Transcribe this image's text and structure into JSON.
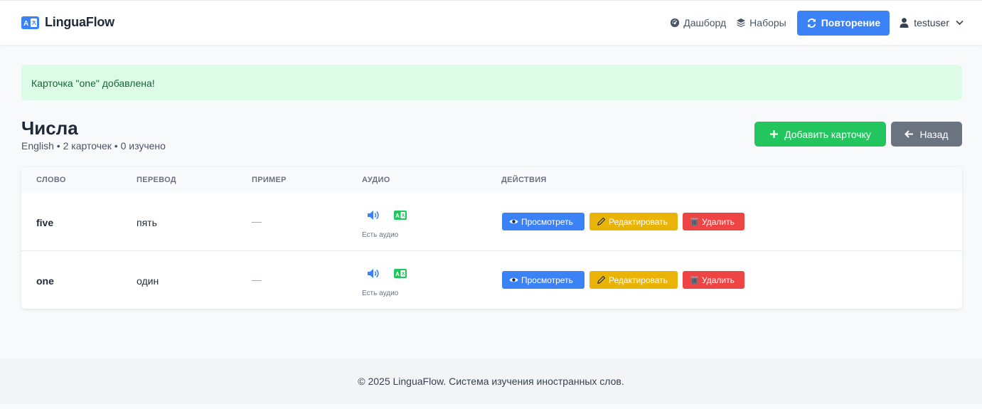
{
  "brand": {
    "name": "LinguaFlow"
  },
  "nav": {
    "dashboard": "Дашборд",
    "sets": "Наборы",
    "review": "Повторение",
    "user": "testuser"
  },
  "alert": {
    "text": "Карточка \"one\" добавлена!"
  },
  "page": {
    "title": "Числа",
    "subtitle": "English • 2 карточек • 0 изучено",
    "add_button": "Добавить карточку",
    "back_button": "Назад"
  },
  "table": {
    "headers": [
      "СЛОВО",
      "ПЕРЕВОД",
      "ПРИМЕР",
      "АУДИО",
      "ДЕЙСТВИЯ"
    ],
    "rows": [
      {
        "word": "five",
        "translation": "пять",
        "example": "—",
        "audio_note": "Есть аудио"
      },
      {
        "word": "one",
        "translation": "один",
        "example": "—",
        "audio_note": "Есть аудио"
      }
    ],
    "actions": {
      "view": "Просмотреть",
      "edit": "Редактировать",
      "delete": "Удалить"
    }
  },
  "footer": {
    "text": "© 2025 LinguaFlow. Система изучения иностранных слов."
  },
  "colors": {
    "primary": "#3b82f6",
    "success": "#22c55e",
    "secondary": "#6b7280",
    "warning": "#eab308",
    "danger": "#ef4444",
    "alert_bg": "#dcfce7",
    "alert_text": "#166534"
  },
  "icons": {
    "brand": "language-icon",
    "dashboard": "gauge-icon",
    "sets": "layers-icon",
    "review": "refresh-icon",
    "user": "user-icon",
    "add": "plus-icon",
    "back": "arrow-left-icon",
    "audio": "volume-icon",
    "translate": "language-icon",
    "view": "eye-icon",
    "edit": "pencil-icon",
    "delete": "trash-icon"
  }
}
